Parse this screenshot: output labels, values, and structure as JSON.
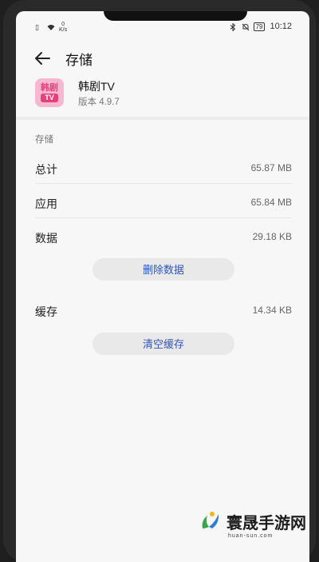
{
  "status_bar": {
    "net_speed_value": "0",
    "net_speed_unit": "K/s",
    "battery": "79",
    "time": "10:12"
  },
  "toolbar": {
    "title": "存储"
  },
  "app": {
    "name": "韩剧TV",
    "version": "版本 4.9.7",
    "icon_text_top": "韩剧",
    "icon_text_bottom": "TV"
  },
  "storage": {
    "section_title": "存储",
    "total_label": "总计",
    "total_value": "65.87 MB",
    "app_label": "应用",
    "app_value": "65.84 MB",
    "data_label": "数据",
    "data_value": "29.18 KB",
    "clear_data_label": "删除数据",
    "cache_label": "缓存",
    "cache_value": "14.34 KB",
    "clear_cache_label": "清空缓存"
  },
  "watermark": {
    "title": "寰晟手游网",
    "url": "huan-sun.com"
  },
  "icons": [
    "sim-icon",
    "wifi-icon",
    "bluetooth-icon",
    "mute-icon",
    "battery-icon",
    "back-arrow-icon",
    "watermark-logo-icon"
  ],
  "colors": {
    "accent": "#2f55b8",
    "app_icon_bg": "#f7b7cf",
    "app_icon_fg": "#e4417a"
  }
}
